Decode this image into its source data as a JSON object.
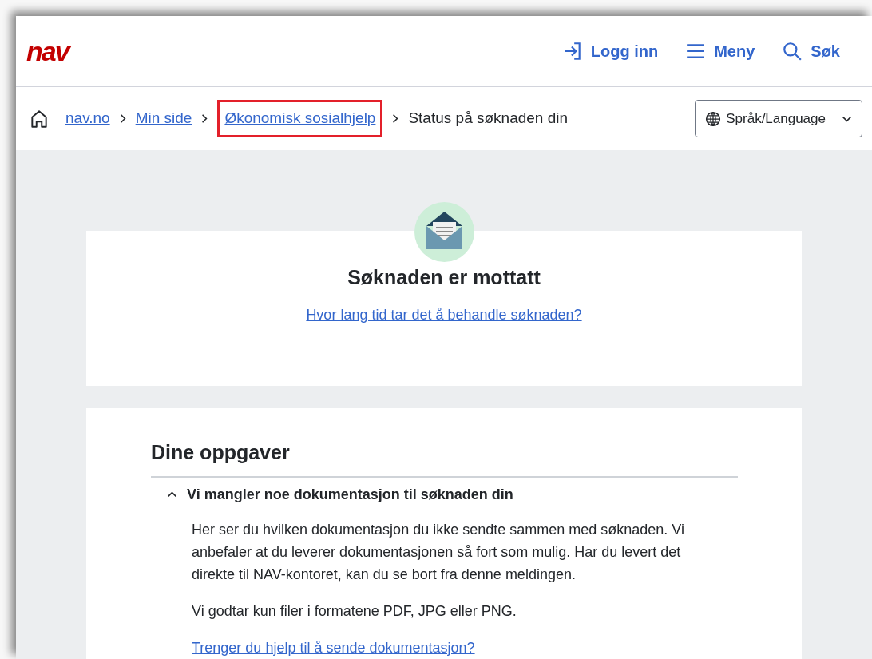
{
  "header": {
    "logo": "nav",
    "actions": [
      {
        "kind": "login",
        "label": "Logg inn"
      },
      {
        "kind": "menu",
        "label": "Meny"
      },
      {
        "kind": "search",
        "label": "Søk"
      }
    ]
  },
  "breadcrumbs": [
    {
      "label": "nav.no",
      "link": true,
      "highlighted": false
    },
    {
      "label": "Min side",
      "link": true,
      "highlighted": false
    },
    {
      "label": "Økonomisk sosialhjelp",
      "link": true,
      "highlighted": true
    },
    {
      "label": "Status på søknaden din",
      "link": false,
      "highlighted": false
    }
  ],
  "language_button": {
    "label": "Språk/Language"
  },
  "status_card": {
    "title": "Søknaden er mottatt",
    "link": "Hvor lang tid tar det å behandle søknaden?"
  },
  "tasks": {
    "title": "Dine oppgaver",
    "accordion": {
      "heading": "Vi mangler noe dokumentasjon til søknaden din",
      "expanded": true,
      "paragraphs": [
        "Her ser du hvilken dokumentasjon du ikke sendte sammen med søknaden. Vi anbefaler at du leverer dokumentasjonen så fort som mulig. Har du levert det direkte til NAV-kontoret, kan du se bort fra denne meldingen.",
        "Vi godtar kun filer i formatene PDF, JPG eller PNG."
      ],
      "link": "Trenger du hjelp til å sende dokumentasjon?"
    }
  }
}
